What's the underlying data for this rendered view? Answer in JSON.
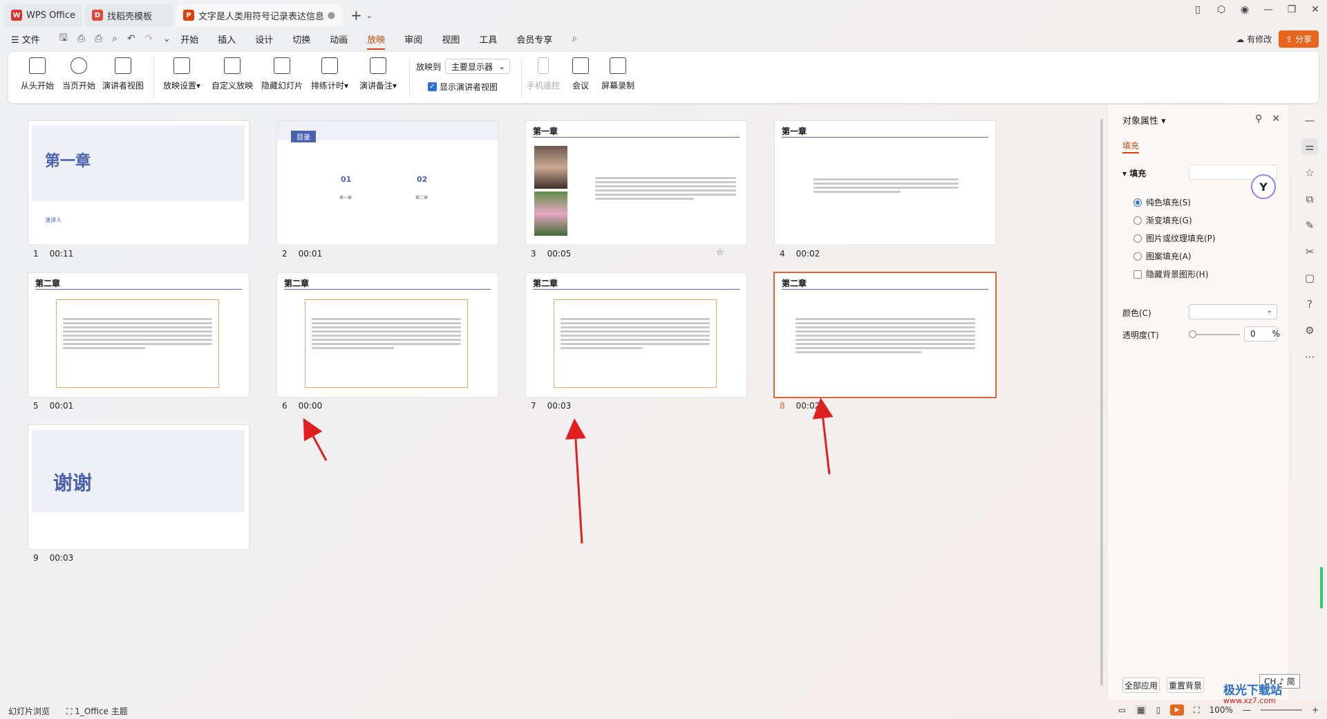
{
  "tabs": [
    {
      "label": "WPS Office",
      "icon": "wps-logo-icon",
      "color": "#d9342b"
    },
    {
      "label": "找稻壳模板",
      "icon": "docer-icon",
      "color": "#e0493e"
    },
    {
      "label": "文字是人类用符号记录表达信息以",
      "icon": "ppt-icon",
      "color": "#d9430a"
    }
  ],
  "menu": {
    "file": "文件",
    "items": [
      "开始",
      "插入",
      "设计",
      "切换",
      "动画",
      "放映",
      "审阅",
      "视图",
      "工具",
      "会员专享"
    ],
    "active": "放映",
    "modify": "有修改",
    "share": "分享"
  },
  "ribbon": {
    "from_start": "从头开始",
    "from_current": "当页开始",
    "presenter_view": "演讲者视图",
    "play_settings": "放映设置",
    "custom_show": "自定义放映",
    "hide_slide": "隐藏幻灯片",
    "rehearse": "排练计时",
    "speaker_notes": "演讲备注",
    "play_to_label": "放映到",
    "play_to_value": "主要显示器",
    "show_presenter": "显示演讲者视图",
    "phone_remote": "手机遥控",
    "meeting": "会议",
    "screen_record": "屏幕录制"
  },
  "slides": [
    {
      "num": "1",
      "time": "00:11",
      "title": "第一章",
      "presenter": "演讲人"
    },
    {
      "num": "2",
      "time": "00:01",
      "toc_title": "目录",
      "toc_items": [
        "01",
        "02"
      ],
      "toc_subs": [
        "第一章",
        "第二章"
      ]
    },
    {
      "num": "3",
      "time": "00:05",
      "title": "第一章"
    },
    {
      "num": "4",
      "time": "00:02",
      "title": "第一章"
    },
    {
      "num": "5",
      "time": "00:01",
      "title": "第二章"
    },
    {
      "num": "6",
      "time": "00:00",
      "title": "第二章"
    },
    {
      "num": "7",
      "time": "00:03",
      "title": "第二章"
    },
    {
      "num": "8",
      "time": "00:02",
      "title": "第二章"
    },
    {
      "num": "9",
      "time": "00:03",
      "title": "谢谢"
    }
  ],
  "panel": {
    "title": "对象属性",
    "tab": "填充",
    "fill_header": "填充",
    "options": [
      "纯色填充(S)",
      "渐变填充(G)",
      "图片或纹理填充(P)",
      "图案填充(A)"
    ],
    "hide_bg": "隐藏背景图形(H)",
    "color_label": "颜色(C)",
    "transparency_label": "透明度(T)",
    "transparency_value": "0",
    "transparency_unit": "%",
    "apply_all": "全部应用",
    "reset_bg": "重置背景"
  },
  "status": {
    "view_mode": "幻灯片浏览",
    "theme": "1_Office 主题",
    "zoom": "100%"
  },
  "ime": "CH ♪ 简",
  "watermark": {
    "name": "极光下载站",
    "url": "www.xz7.com"
  },
  "colors": {
    "accent": "#d9430a",
    "selection": "#e06434",
    "arrow": "#e02020"
  }
}
